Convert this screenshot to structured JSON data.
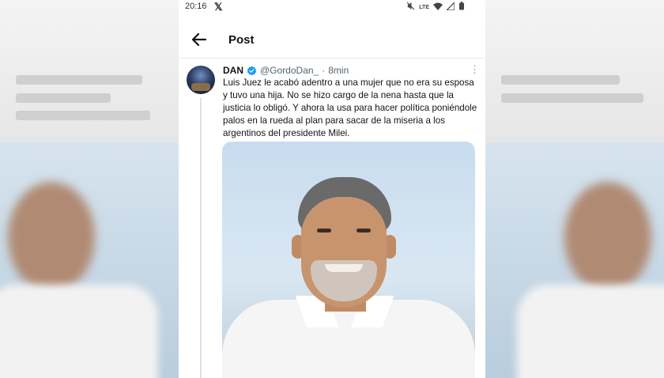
{
  "status_bar": {
    "time": "20:16",
    "network_label": "LTE"
  },
  "nav": {
    "title": "Post"
  },
  "post": {
    "display_name": "DAN",
    "handle": "@GordoDan_",
    "separator": "·",
    "time_ago": "8min",
    "text": "Luis Juez le acabó adentro a una mujer que no era su esposa y tuvo una hija. No se hizo cargo de la nena hasta que la justicia lo obligó. Y ahora la usa para hacer política poniéndole palos en la rueda al plan para sacar de la miseria a los argentinos del presidente Milei.",
    "more_glyph": "⋮"
  },
  "colors": {
    "verified": "#1d9bf0",
    "text": "#0f1419",
    "muted": "#536471"
  },
  "icons": {
    "back": "arrow-left-icon",
    "x_logo": "x-logo-icon",
    "verified": "verified-badge-icon",
    "more": "more-vertical-icon"
  }
}
